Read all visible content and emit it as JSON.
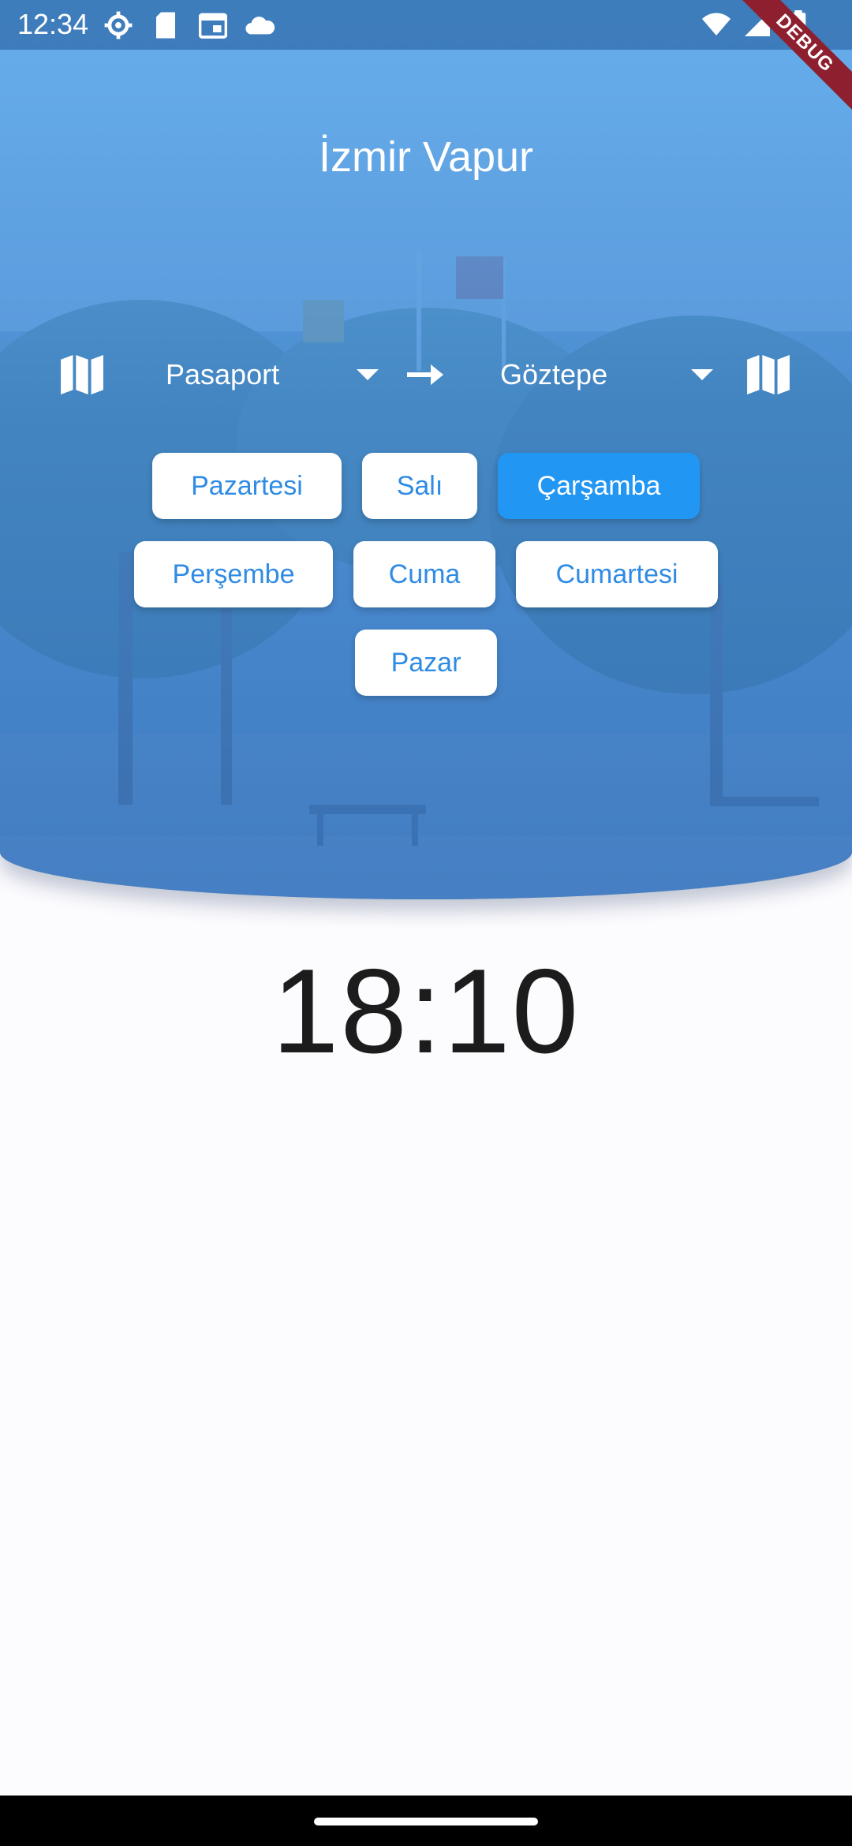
{
  "status_bar": {
    "time": "12:34",
    "left_icons": [
      "settings-icon",
      "sd-card-icon",
      "calendar-icon",
      "cloud-icon"
    ],
    "right_icons": [
      "wifi-icon",
      "signal-icon",
      "battery-icon"
    ]
  },
  "debug_banner": "DEBUG",
  "header": {
    "title": "İzmir Vapur"
  },
  "route": {
    "from": "Pasaport",
    "to": "Göztepe",
    "from_icon": "map-icon",
    "to_icon": "map-icon",
    "separator_icon": "arrow-right-icon"
  },
  "days": {
    "items": [
      "Pazartesi",
      "Salı",
      "Çarşamba",
      "Perşembe",
      "Cuma",
      "Cumartesi",
      "Pazar"
    ],
    "selected": "Çarşamba"
  },
  "next_departure": "18:10",
  "colors": {
    "primary": "#2196f3",
    "button_text": "#2f8be4",
    "header_tint": "#4a90d9"
  }
}
